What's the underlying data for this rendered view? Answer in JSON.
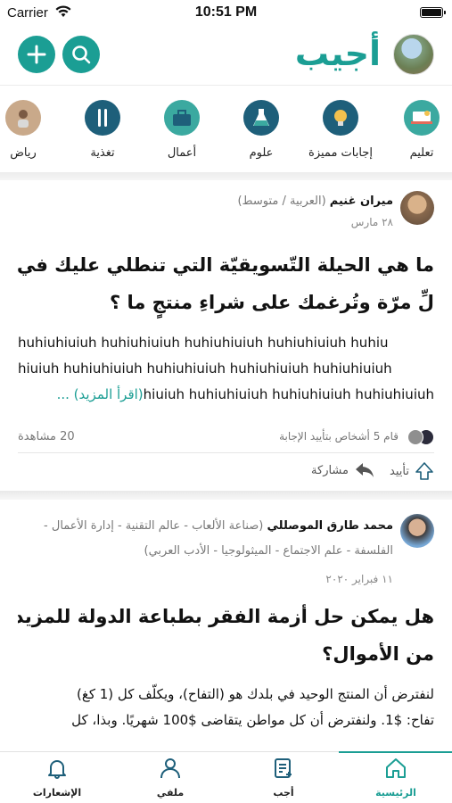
{
  "status": {
    "carrier": "Carrier",
    "time": "10:51 PM"
  },
  "header": {
    "logo": "أجيب"
  },
  "topics": [
    {
      "label": "تعليم",
      "icon": "education-icon",
      "color": "#3ba9a0"
    },
    {
      "label": "إجابات مميزة",
      "icon": "lightbulb-icon",
      "color": "#1e5f7a"
    },
    {
      "label": "علوم",
      "icon": "flask-icon",
      "color": "#1e5f7a"
    },
    {
      "label": "أعمال",
      "icon": "briefcase-icon",
      "color": "#3ba9a0"
    },
    {
      "label": "تغذية",
      "icon": "utensils-icon",
      "color": "#1e5f7a"
    },
    {
      "label": "رياض",
      "icon": "sports-icon",
      "color": "#c9a98a"
    }
  ],
  "post1": {
    "author": "ميران غنيم",
    "credentials": "(العربية / متوسط)",
    "date": "٢٨ مارس",
    "title_line1": "ما هي الحيلة التّسويقيّة التي تنطلي عليك في ك",
    "title_line2": "لِّ مرّة وتُرغمك على شراءِ منتجٍ ما ؟",
    "body_line1": "huhiuhiuiuh huhiuhiuiuh huhiuhiuiuh huhiuhiuiuh huhiu",
    "body_line2": "hiuiuh huhiuhiuiuh huhiuhiuiuh huhiuhiuiuh huhiuhiuiuh",
    "body_line3": "hiuiuh huhiuhiuiuh huhiuhiuiuh huhiuhiuiuh",
    "read_more": "... (اقرأ المزيد)",
    "upvoters": "قام 5 أشخاص بتأييد الإجابة",
    "views": "20 مشاهدة",
    "upvote_label": "تأييد",
    "share_label": "مشاركة"
  },
  "post2": {
    "author": "محمد طارق الموصللي",
    "credentials_line1": "(صناعة الألعاب - عالم التقنية - إدارة الأعمال -",
    "credentials_line2": "الفلسفة - علم الاجتماع - الميثولوجيا - الأدب العربي)",
    "date": "١١ فبراير ٢٠٢٠",
    "title_line1": "هل يمكن حل أزمة الفقر بطباعة الدولة للمزيد",
    "title_line2": "من الأموال؟",
    "body_line1": "لنفترض أن المنتج الوحيد في بلدك هو (التفاح)، ويكلّف كل (1 كغ)",
    "body_line2": "تفاح: $1. ولنفترض أن كل مواطن يتقاضى $100 شهريًا. وبذا، كل"
  },
  "tabs": [
    {
      "label": "الرئيسية",
      "icon": "home-icon",
      "active": true
    },
    {
      "label": "أجب",
      "icon": "write-icon",
      "active": false
    },
    {
      "label": "ملفي",
      "icon": "profile-icon",
      "active": false
    },
    {
      "label": "الإشعارات",
      "icon": "bell-icon",
      "active": false
    }
  ],
  "colors": {
    "accent": "#1b9e94",
    "dark_teal": "#1e5f7a"
  }
}
